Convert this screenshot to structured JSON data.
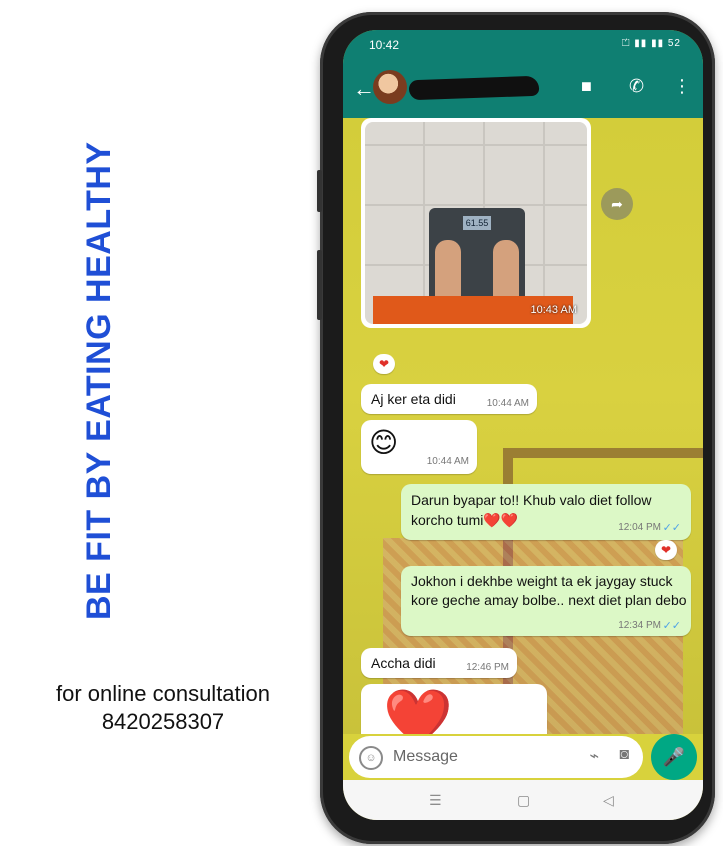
{
  "poster": {
    "title": "BE FIT BY EATING HEALTHY",
    "consult_line1": "for online consultation",
    "consult_line2": "8420258307"
  },
  "status_bar": {
    "time": "10:42",
    "icons": "⏍ ▮▮ ▮▮ 52"
  },
  "app_bar": {
    "back_icon": "arrow-left",
    "video_icon": "video-camera",
    "call_icon": "phone",
    "menu_icon": "more-vertical"
  },
  "messages": [
    {
      "type": "image",
      "direction": "in",
      "scale_reading": "61.55",
      "time": "10:43 AM",
      "reaction": "❤"
    },
    {
      "type": "text",
      "direction": "in",
      "text": "Aj ker eta didi",
      "time": "10:44 AM"
    },
    {
      "type": "emoji",
      "direction": "in",
      "text": "😊",
      "time": "10:44 AM"
    },
    {
      "type": "text",
      "direction": "out",
      "text": "Darun byapar to!! Khub valo diet follow korcho tumi❤️❤️",
      "time": "12:04 PM",
      "ticks": "✓✓",
      "reaction": "❤"
    },
    {
      "type": "text",
      "direction": "out",
      "text": "Jokhon i dekhbe weight ta ek jaygay stuck kore geche amay bolbe.. next diet plan debo",
      "time": "12:34 PM",
      "ticks": "✓✓"
    },
    {
      "type": "text",
      "direction": "in",
      "text": "Accha didi",
      "time": "12:46 PM"
    },
    {
      "type": "emoji",
      "direction": "in",
      "text": "❤️"
    }
  ],
  "input": {
    "placeholder": "Message"
  },
  "nav": {
    "menu": "☰",
    "home": "▢",
    "back": "◁"
  },
  "colors": {
    "header": "#0f7f72",
    "outgoing": "#dcf8c6",
    "accent": "#00a884",
    "title_blue": "#1f4fd6"
  }
}
